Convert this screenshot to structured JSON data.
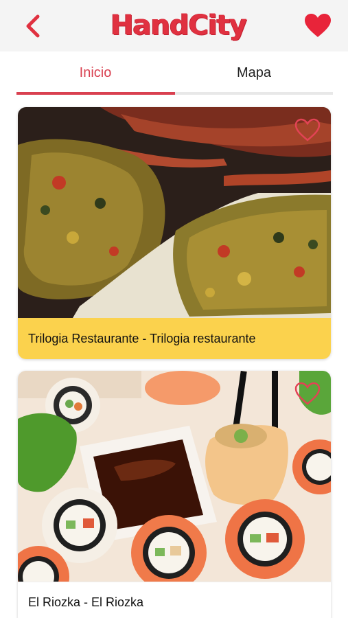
{
  "app": {
    "logo_text": "HandCity",
    "brand_color": "#e03140",
    "back_icon": "chevron-left-icon",
    "favorites_icon": "heart-icon"
  },
  "tabs": {
    "items": [
      {
        "label": "Inicio",
        "active": true
      },
      {
        "label": "Mapa",
        "active": false
      }
    ],
    "active_color": "#d94050"
  },
  "restaurants": [
    {
      "title": "Trilogia Restaurante - Trilogia restaurante",
      "image": "stuffed crab dish",
      "footer_color": "#fbd24d",
      "favorite_icon": "heart-outline-icon"
    },
    {
      "title": "El Riozka - El Riozka",
      "image": "sushi rolls with soy sauce",
      "footer_color": "#ffffff",
      "favorite_icon": "heart-outline-icon"
    }
  ]
}
